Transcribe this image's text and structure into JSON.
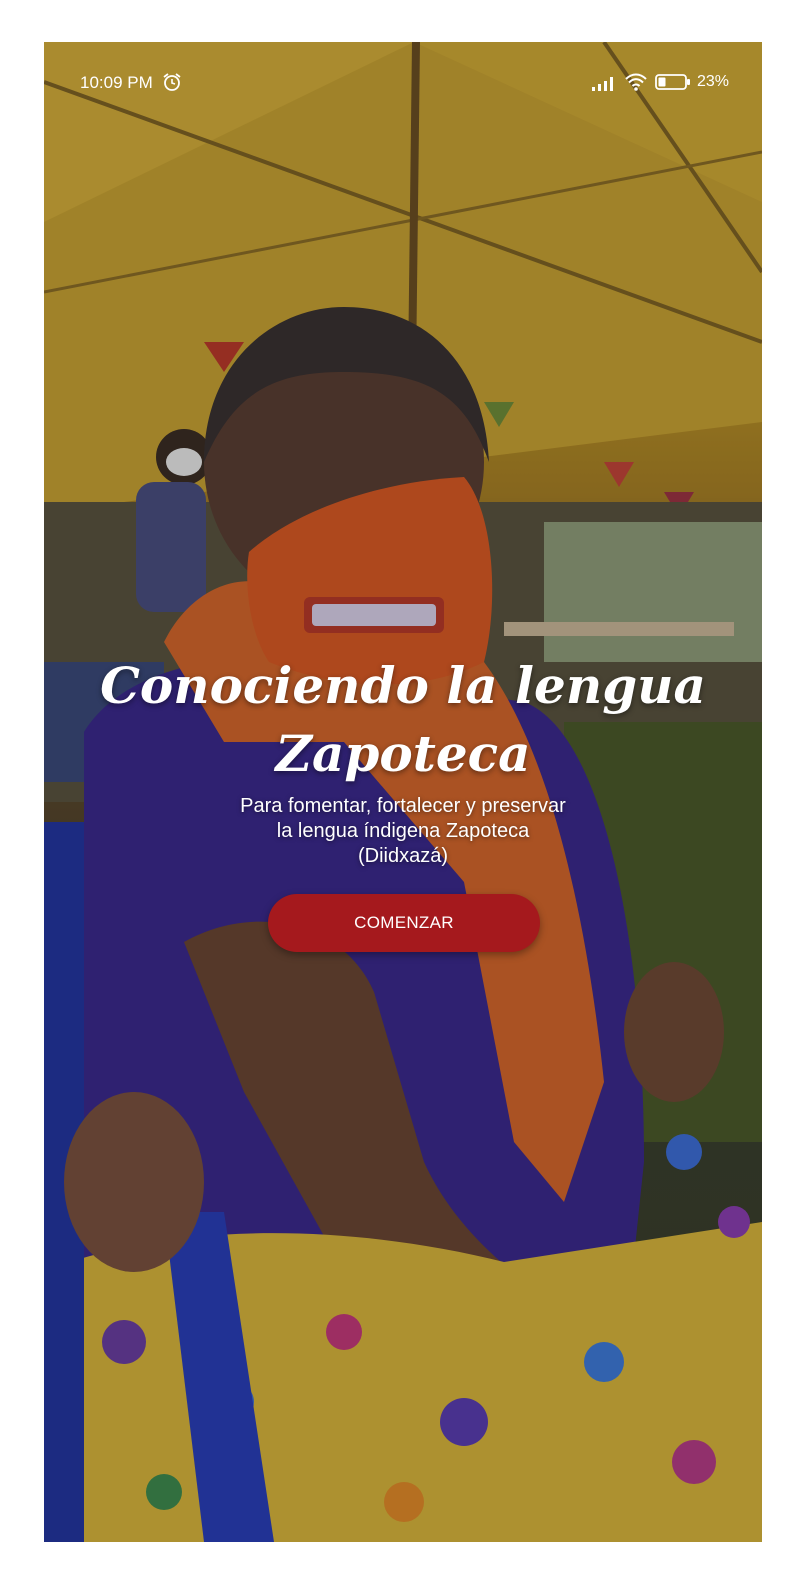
{
  "status_bar": {
    "time": "10:09 PM",
    "battery": "23%",
    "icons": [
      "alarm-icon",
      "signal-icon",
      "wifi-icon",
      "battery-icon"
    ]
  },
  "hero": {
    "title": "Conociendo la lengua Zapoteca",
    "subtitle": "Para fomentar, fortalecer y preservar la lengua índigena Zapoteca (Diidxazá)"
  },
  "actions": {
    "start_label": "COMENZAR"
  },
  "colors": {
    "button": "#a5191d",
    "text": "#ffffff"
  }
}
